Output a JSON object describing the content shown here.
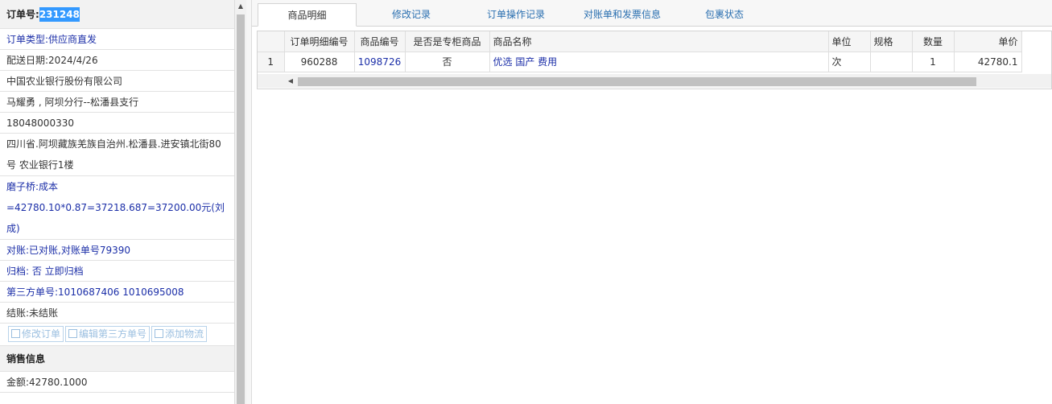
{
  "order": {
    "number_label": "订单号:",
    "number_value": "231248",
    "type": "订单类型:供应商直发",
    "delivery_date": "配送日期:2024/4/26",
    "company": "中国农业银行股份有限公司",
    "contact": "马耀勇 , 阿坝分行--松潘县支行",
    "phone": "18048000330",
    "address": "四川省.阿坝藏族羌族自治州.松潘县.进安镇北街80号 农业银行1楼",
    "mozi_bridge": "磨子桥:成本=42780.10*0.87=37218.687=37200.00元(刘成)",
    "reconcile": "对账:已对账,对账单号79390",
    "archive": "归档: 否 立即归档",
    "third_party": "第三方单号:1010687406 1010695008",
    "settlement": "结账:未结账"
  },
  "buttons": {
    "edit_order": "修改订单",
    "edit_third_party": "编辑第三方单号",
    "add_logistics": "添加物流"
  },
  "sales": {
    "title": "销售信息",
    "amount": "金额:42780.1000"
  },
  "tabs": [
    "商品明细",
    "修改记录",
    "订单操作记录",
    "对账单和发票信息",
    "包裹状态"
  ],
  "table": {
    "columns": [
      "",
      "订单明细编号",
      "商品编号",
      "是否是专柜商品",
      "商品名称",
      "单位",
      "规格",
      "数量",
      "单价"
    ],
    "rows": [
      [
        "1",
        "960288",
        "1098726",
        "否",
        "优选 国产 费用",
        "次",
        "",
        "1",
        "42780.1"
      ]
    ]
  },
  "icons": {
    "edit": "edit-icon",
    "scroll_up": "arrow-up-icon",
    "scroll_left": "arrow-left-icon"
  }
}
